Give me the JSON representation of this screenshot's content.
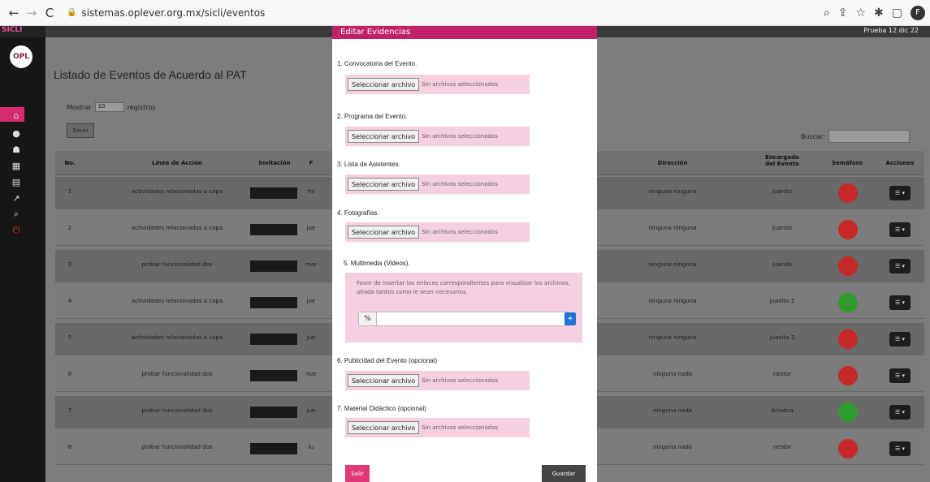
{
  "browser": {
    "url": "sistemas.oplever.org.mx/sicli/eventos",
    "back_icon": "←",
    "forward_icon": "→",
    "reload_icon": "C",
    "lock_icon": "🔒",
    "right_icons": [
      "⌕",
      "⇪",
      "☆",
      "✱",
      "▢"
    ],
    "avatar": "F"
  },
  "app": {
    "brand": "SICLI",
    "user_label": "Prueba 12 dic 22",
    "logo_text": "OPL",
    "page_title": "Listado de Eventos de Acuerdo al PAT",
    "show_label": "Mostrar",
    "show_value": "10",
    "records_label": "registros",
    "excel_label": "Excel",
    "search_label": "Buscar:"
  },
  "table": {
    "headers": [
      "No.",
      "Línea de Acción",
      "Invitación",
      "F",
      "Dirección",
      "Encargado del Evento",
      "Semáforo",
      "Acciones"
    ],
    "rows": [
      {
        "no": "1",
        "linea": "actividades relacionadas a capa",
        "fecha": "mi",
        "direccion": "ninguna ninguna",
        "encargado": "juanito",
        "semaforo": "#c62828"
      },
      {
        "no": "2",
        "linea": "actividades relacionadas a capa",
        "fecha": "jue",
        "direccion": "ninguna ninguna",
        "encargado": "juanito",
        "semaforo": "#c62828"
      },
      {
        "no": "3",
        "linea": "probar funcionalidad dos",
        "fecha": "mar",
        "direccion": "ninguna ninguna",
        "encargado": "juanito",
        "semaforo": "#c62828"
      },
      {
        "no": "4",
        "linea": "actividades relacionadas a capa",
        "fecha": "jue",
        "direccion": "ninguna ninguna",
        "encargado": "juanito 2",
        "semaforo": "#2e9d2e"
      },
      {
        "no": "5",
        "linea": "actividades relacionadas a capa",
        "fecha": "jue",
        "direccion": "ninguna ninguna",
        "encargado": "juanito 3",
        "semaforo": "#c62828"
      },
      {
        "no": "6",
        "linea": "probar funcionalidad dos",
        "fecha": "mar",
        "direccion": "ninguna nada",
        "encargado": "nestor",
        "semaforo": "#c62828"
      },
      {
        "no": "7",
        "linea": "probar funcionalidad dos",
        "fecha": "jue",
        "direccion": "ninguna nada",
        "encargado": "Ariadna",
        "semaforo": "#2e9d2e"
      },
      {
        "no": "8",
        "linea": "probar funcionalidad dos",
        "fecha": "lu",
        "direccion": "ninguna nada",
        "encargado": "nestor",
        "semaforo": "#c62828"
      }
    ]
  },
  "modal": {
    "title": "Editar Evidencias",
    "file_button": "Seleccionar archivo",
    "file_status": "Sin archivos seleccionados",
    "fields": [
      "1. Convocatoria del Evento.",
      "2. Programa del Evento.",
      "3. Lista de Asistentes.",
      "4. Fotografías.",
      "5. Multimedia (Videos).",
      "6. Publicidad del Evento (opcional)",
      "7. Material Didáctico (opcional)"
    ],
    "multimedia_help": "Favor de insertar los enlaces correspondientes para visualizar los archivos, añada tantos como le sean necesarios.",
    "link_icon": "%",
    "add_icon": "+",
    "close_label": "Salir",
    "save_label": "Guardar"
  },
  "colors": {
    "accent": "#c0226a",
    "field_bg": "#f6cfe0",
    "overlay": "#7d7d7d"
  }
}
